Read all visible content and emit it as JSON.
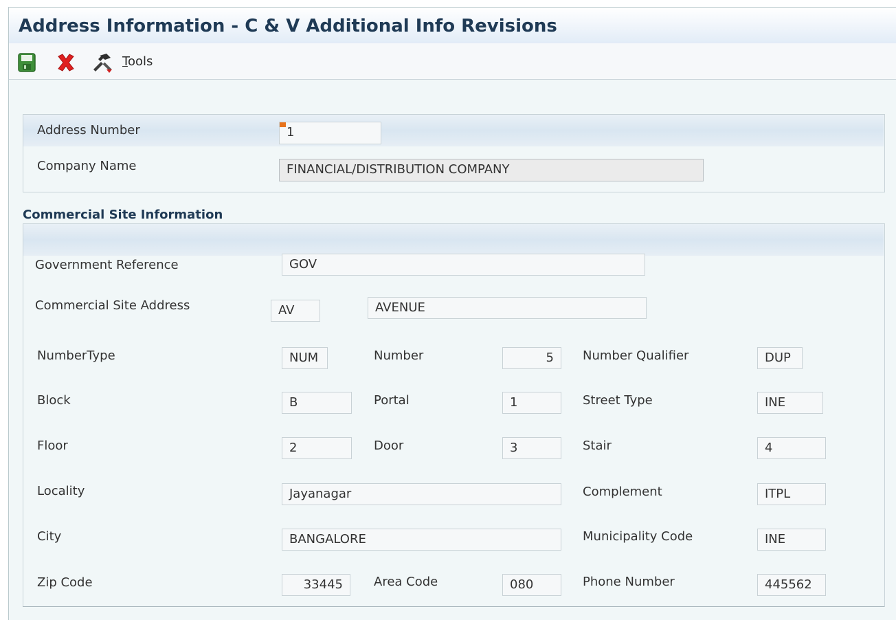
{
  "window": {
    "title": "Address Information - C & V Additional Info Revisions"
  },
  "toolbar": {
    "save_icon": "save-disk-icon",
    "cancel_icon": "close-x-icon",
    "tools_icon": "tools-hammer-icon",
    "tools_label_first": "T",
    "tools_label_rest": "ools"
  },
  "header": {
    "address_number_label": "Address Number",
    "address_number_value": "1",
    "company_name_label": "Company Name",
    "company_name_value": "FINANCIAL/DISTRIBUTION COMPANY"
  },
  "commercial": {
    "section_title": "Commercial Site Information",
    "gov_ref_label": "Government Reference",
    "gov_ref_value": "GOV",
    "site_address_label": "Commercial Site Address",
    "site_address_code": "AV",
    "site_address_desc": "AVENUE",
    "number_type_label": "NumberType",
    "number_type_value": "NUM",
    "number_label": "Number",
    "number_value": "5",
    "number_qualifier_label": "Number Qualifier",
    "number_qualifier_value": "DUP",
    "block_label": "Block",
    "block_value": "B",
    "portal_label": "Portal",
    "portal_value": "1",
    "street_type_label": "Street Type",
    "street_type_value": "INE",
    "floor_label": "Floor",
    "floor_value": "2",
    "door_label": "Door",
    "door_value": "3",
    "stair_label": "Stair",
    "stair_value": "4",
    "locality_label": "Locality",
    "locality_value": "Jayanagar",
    "complement_label": "Complement",
    "complement_value": "ITPL",
    "city_label": "City",
    "city_value": "BANGALORE",
    "municipality_label": "Municipality Code",
    "municipality_value": "INE",
    "zip_label": "Zip Code",
    "zip_value": "33445",
    "area_code_label": "Area Code",
    "area_code_value": "080",
    "phone_label": "Phone Number",
    "phone_value": "445562"
  },
  "colors": {
    "title": "#1f3a55",
    "required_marker": "#e8731c",
    "cancel_red": "#e02020",
    "save_green": "#3f8f3a"
  }
}
